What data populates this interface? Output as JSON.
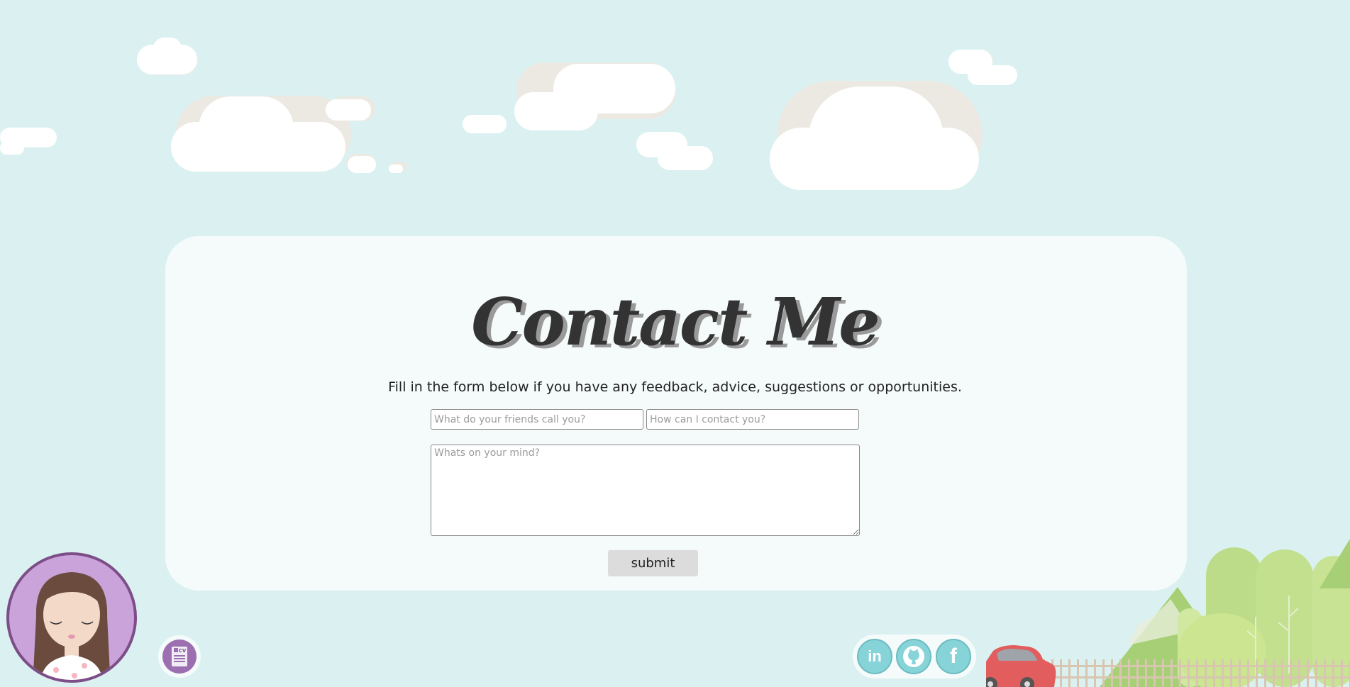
{
  "page": {
    "title": "Contact Me",
    "subtitle": "Fill in the form below if you have any feedback, advice, suggestions or opportunities."
  },
  "form": {
    "name_placeholder": "What do your friends call you?",
    "contact_placeholder": "How can I contact you?",
    "message_placeholder": "Whats on your mind?",
    "submit_label": "submit"
  },
  "cv_button": {
    "label": "CV",
    "icon": "cv-document-icon"
  },
  "social": [
    {
      "name": "linkedin",
      "label": "in",
      "icon": "linkedin-icon"
    },
    {
      "name": "github",
      "label": "",
      "icon": "github-icon"
    },
    {
      "name": "facebook",
      "label": "f",
      "icon": "facebook-icon"
    }
  ],
  "colors": {
    "background": "#dbf1f1",
    "card": "#f4fbfa",
    "social_accent": "#86d3d8",
    "avatar_ring": "#c9a3d9",
    "title_text": "#333333"
  }
}
